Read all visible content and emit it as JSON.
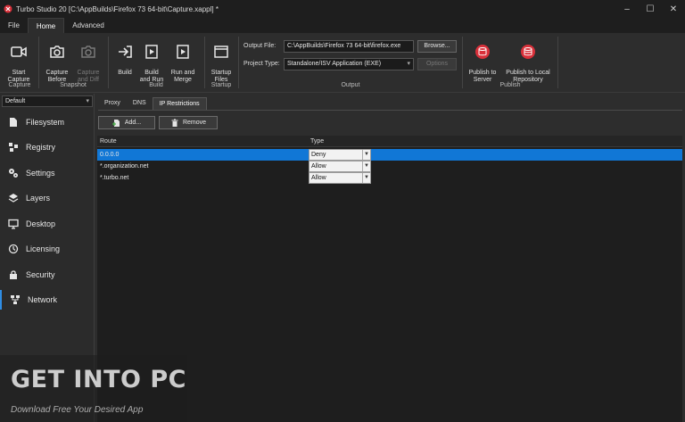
{
  "window": {
    "title": "Turbo Studio 20 [C:\\AppBuilds\\Firefox 73 64-bit\\Capture.xappl] *",
    "controls": {
      "minimize": "–",
      "maximize": "☐",
      "close": "✕"
    }
  },
  "tabs": [
    {
      "label": "File"
    },
    {
      "label": "Home"
    },
    {
      "label": "Advanced"
    }
  ],
  "ribbon": {
    "capture": {
      "start_capture": "Start\nCapture",
      "group": "Capture"
    },
    "snapshot": {
      "capture_before": "Capture\nBefore",
      "capture_and_diff": "Capture\nand Diff",
      "group": "Snapshot"
    },
    "build": {
      "build": "Build",
      "build_and_run": "Build\nand Run",
      "run_and_merge": "Run and\nMerge",
      "group": "Build"
    },
    "startup": {
      "startup_files": "Startup\nFiles",
      "group": "Startup"
    },
    "output": {
      "output_file_label": "Output File:",
      "output_file_value": "C:\\AppBuilds\\Firefox 73 64-bit\\firefox.exe",
      "browse": "Browse...",
      "project_type_label": "Project Type:",
      "project_type_value": "Standalone/ISV Application (EXE)",
      "options": "Options",
      "group": "Output"
    },
    "publish": {
      "publish_to_server": "Publish to\nServer",
      "publish_to_local": "Publish to Local\nRepository",
      "group": "Publish"
    }
  },
  "sidebar": {
    "profile": "Default",
    "items": [
      {
        "label": "Filesystem",
        "icon": "filesystem-icon"
      },
      {
        "label": "Registry",
        "icon": "registry-icon"
      },
      {
        "label": "Settings",
        "icon": "settings-icon"
      },
      {
        "label": "Layers",
        "icon": "layers-icon"
      },
      {
        "label": "Desktop",
        "icon": "desktop-icon"
      },
      {
        "label": "Licensing",
        "icon": "licensing-icon"
      },
      {
        "label": "Security",
        "icon": "security-icon"
      },
      {
        "label": "Network",
        "icon": "network-icon"
      }
    ]
  },
  "content": {
    "subtabs": [
      {
        "label": "Proxy"
      },
      {
        "label": "DNS"
      },
      {
        "label": "IP Restrictions"
      }
    ],
    "add_button": "Add...",
    "remove_button": "Remove",
    "table": {
      "columns": [
        "Route",
        "Type"
      ],
      "rows": [
        {
          "route": "0.0.0.0",
          "type": "Deny"
        },
        {
          "route": "*.organization.net",
          "type": "Allow"
        },
        {
          "route": "*.turbo.net",
          "type": "Allow"
        }
      ]
    }
  },
  "watermark": {
    "title": "GET INTO PC",
    "subtitle": "Download Free Your Desired App"
  },
  "colors": {
    "accent": "#1177d6",
    "publish_red": "#d9303a",
    "background": "#2d2d2d"
  }
}
